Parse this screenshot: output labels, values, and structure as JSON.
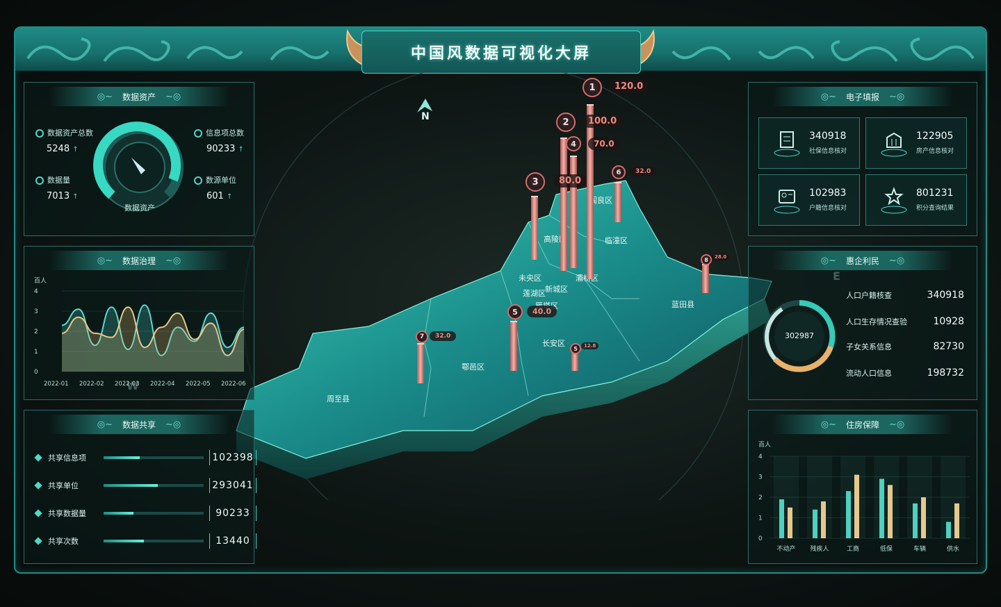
{
  "title": "中国风数据可视化大屏",
  "compass": {
    "north": "N",
    "east": "E",
    "west": "W"
  },
  "data_assets": {
    "heading": "数据资产",
    "gauge_label": "数据资产",
    "stats": [
      {
        "label": "数据资产总数",
        "value": "5248"
      },
      {
        "label": "信息项总数",
        "value": "90233"
      },
      {
        "label": "数据量",
        "value": "7013"
      },
      {
        "label": "数源单位",
        "value": "601"
      }
    ],
    "arrow": "↑"
  },
  "governance": {
    "heading": "数据治理",
    "unit": "百人",
    "y_ticks": [
      "4",
      "3",
      "2",
      "1",
      "0"
    ],
    "x_ticks": [
      "2022-01",
      "2022-02",
      "2022-03",
      "2022-04",
      "2022-05",
      "2022-06"
    ]
  },
  "sharing": {
    "heading": "数据共享",
    "rows": [
      {
        "label": "共享信息项",
        "value": "102398",
        "fill": 0.36
      },
      {
        "label": "共享单位",
        "value": "293041",
        "fill": 0.54
      },
      {
        "label": "共享数据量",
        "value": "90233",
        "fill": 0.3
      },
      {
        "label": "共享次数",
        "value": "13440",
        "fill": 0.4
      }
    ]
  },
  "e_report": {
    "heading": "电子填报",
    "cards": [
      {
        "value": "340918",
        "label": "社保信息核对",
        "icon": "form-icon"
      },
      {
        "value": "122905",
        "label": "房产信息核对",
        "icon": "building-icon"
      },
      {
        "value": "102983",
        "label": "户籍信息核对",
        "icon": "id-card-icon"
      },
      {
        "value": "801231",
        "label": "积分查询结果",
        "icon": "star-icon"
      }
    ]
  },
  "benefit": {
    "heading": "惠企利民",
    "ring_value": "302987",
    "items": [
      {
        "label": "人口户籍核查",
        "value": "340918"
      },
      {
        "label": "人口生存情况查验",
        "value": "10928"
      },
      {
        "label": "子女关系信息",
        "value": "82730"
      },
      {
        "label": "流动人口信息",
        "value": "198732"
      }
    ]
  },
  "housing": {
    "heading": "住房保障",
    "unit": "百人"
  },
  "map": {
    "districts": [
      "周至县",
      "鄠邑区",
      "长安区",
      "蓝田县",
      "临潼区",
      "阎良区",
      "高陵区",
      "未央区",
      "灞桥区",
      "新城区",
      "莲湖区",
      "雁塔区"
    ],
    "markers": [
      {
        "rank": "1",
        "value": "120.0"
      },
      {
        "rank": "2",
        "value": "100.0"
      },
      {
        "rank": "3",
        "value": "80.0"
      },
      {
        "rank": "4",
        "value": "70.0"
      },
      {
        "rank": "5",
        "value": "40.0"
      },
      {
        "rank": "6",
        "value": "32.0"
      },
      {
        "rank": "7",
        "value": "32.0"
      },
      {
        "rank": "8",
        "value": "28.0"
      },
      {
        "rank": "5",
        "value": "12.8"
      }
    ]
  },
  "chart_data": [
    {
      "type": "line",
      "title": "数据治理",
      "ylabel": "百人",
      "x": [
        "2022-01",
        "2022-02",
        "2022-03",
        "2022-04",
        "2022-05",
        "2022-06"
      ],
      "ylim": [
        0,
        4
      ],
      "series": [
        {
          "values": [
            2.3,
            3.1,
            1.3,
            3.2,
            1.1,
            3.3,
            0.8,
            2.2,
            1.5,
            2.9,
            1.2,
            2.2
          ]
        },
        {
          "values": [
            1.9,
            2.7,
            1.9,
            1.7,
            3.2,
            1.2,
            2.2,
            2.9,
            1.6,
            2.4,
            0.8,
            2.1
          ]
        }
      ]
    },
    {
      "type": "bar",
      "title": "住房保障",
      "ylabel": "百人",
      "categories": [
        "不动产",
        "残疾人",
        "工商",
        "低保",
        "车辆",
        "供水"
      ],
      "ylim": [
        0,
        4
      ],
      "series": [
        {
          "values": [
            1.9,
            1.4,
            2.3,
            2.9,
            1.7,
            0.8
          ]
        },
        {
          "values": [
            1.5,
            1.8,
            3.1,
            2.6,
            2.0,
            1.7
          ]
        }
      ]
    }
  ]
}
